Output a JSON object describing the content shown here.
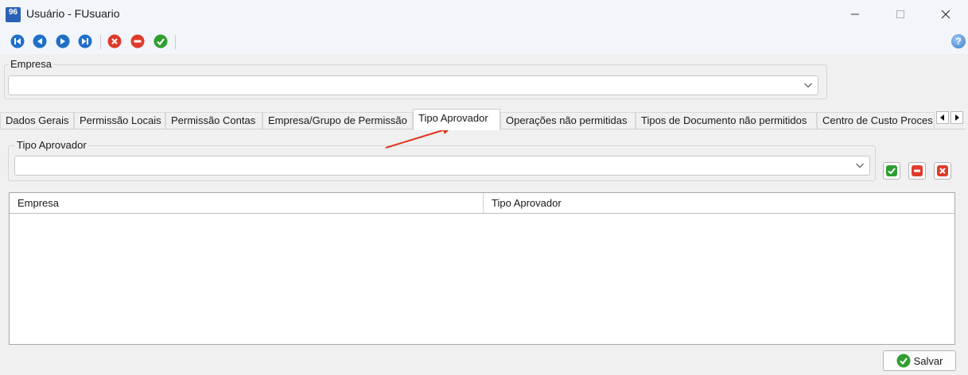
{
  "window": {
    "app_icon_text": "96",
    "title": "Usuário - FUsuario"
  },
  "toolbar": {
    "buttons": [
      "first-icon",
      "previous-icon",
      "next-icon",
      "last-icon",
      "cancel-icon",
      "delete-icon",
      "confirm-icon"
    ],
    "help_label": "?"
  },
  "empresa": {
    "label": "Empresa",
    "value": ""
  },
  "tabs": [
    {
      "label": "Dados Gerais",
      "active": false
    },
    {
      "label": "Permissão Locais",
      "active": false
    },
    {
      "label": "Permissão Contas",
      "active": false
    },
    {
      "label": "Empresa/Grupo de Permissão",
      "active": false
    },
    {
      "label": "Tipo Aprovador",
      "active": true
    },
    {
      "label": "Operações não permitidas",
      "active": false
    },
    {
      "label": "Tipos de Documento não permitidos",
      "active": false
    },
    {
      "label": "Centro de Custo Proces",
      "active": false
    }
  ],
  "tipo_aprovador": {
    "label": "Tipo Aprovador",
    "value": ""
  },
  "grid": {
    "columns": [
      "Empresa",
      "Tipo Aprovador"
    ],
    "rows": []
  },
  "save_button": {
    "label": "Salvar"
  },
  "colors": {
    "accent_blue": "#1f6fc8",
    "cancel_red": "#e03a2a",
    "ok_green": "#2f9e2f",
    "annotation_arrow": "#e0351f"
  }
}
